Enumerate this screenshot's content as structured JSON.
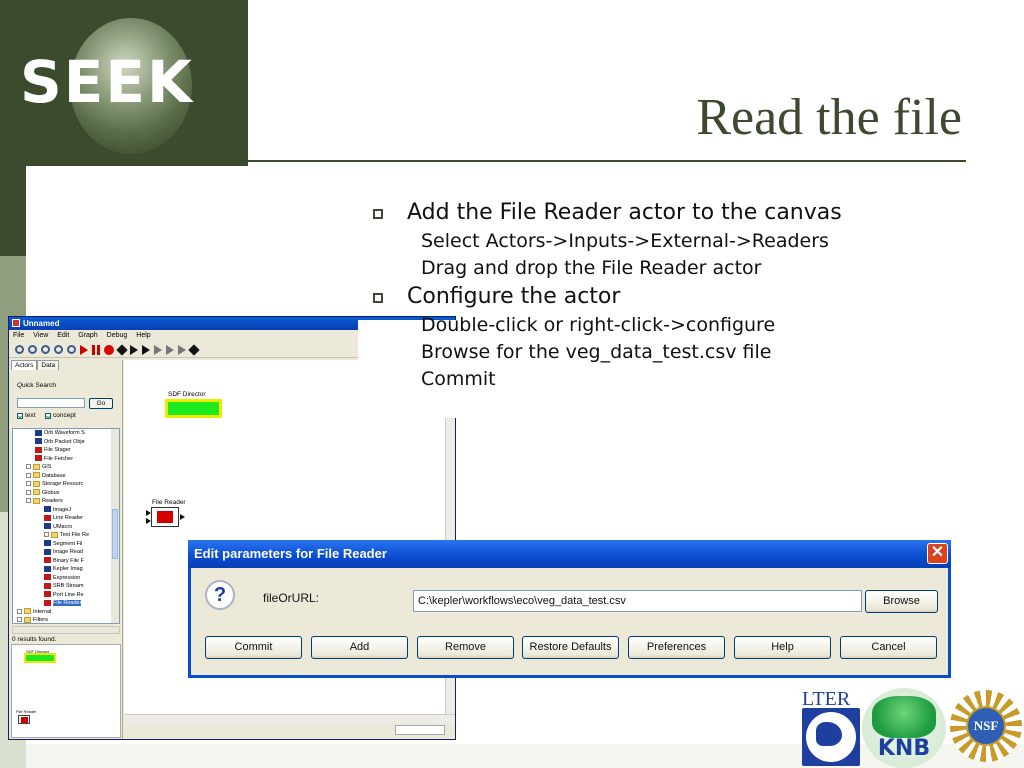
{
  "slide": {
    "logo_text": "SEEK",
    "title": "Read the file",
    "bullets": [
      {
        "text": "Add the File Reader actor to the canvas",
        "sub": [
          "Select Actors->Inputs->External->Readers",
          "Drag and drop the File Reader actor"
        ]
      },
      {
        "text": "Configure the actor",
        "sub": [
          "Double-click or right-click->configure",
          "Browse for the veg_data_test.csv file",
          "Commit"
        ]
      }
    ]
  },
  "kepler": {
    "window_title": "Unnamed",
    "menu": [
      "File",
      "View",
      "Edit",
      "Graph",
      "Debug",
      "Help"
    ],
    "tabs": [
      "Actors",
      "Data"
    ],
    "quick_search_label": "Quick Search",
    "go_label": "Go",
    "checks": [
      "text",
      "concept"
    ],
    "tree": [
      {
        "label": "Orb Waveform S",
        "indent": 4,
        "icon": "actor"
      },
      {
        "label": "Orb Packet Obje",
        "indent": 4,
        "icon": "actor"
      },
      {
        "label": "File Stager",
        "indent": 4,
        "icon": "actor-red"
      },
      {
        "label": "File Fetcher",
        "indent": 4,
        "icon": "actor-red"
      },
      {
        "label": "GIS",
        "indent": 3,
        "icon": "folder"
      },
      {
        "label": "Database",
        "indent": 3,
        "icon": "folder"
      },
      {
        "label": "Storage Resourc",
        "indent": 3,
        "icon": "folder"
      },
      {
        "label": "Globus",
        "indent": 3,
        "icon": "folder"
      },
      {
        "label": "Readers",
        "indent": 3,
        "icon": "folder"
      },
      {
        "label": "ImageJ",
        "indent": 5,
        "icon": "actor"
      },
      {
        "label": "Line Reader",
        "indent": 5,
        "icon": "actor-red"
      },
      {
        "label": "UMacro",
        "indent": 5,
        "icon": "actor"
      },
      {
        "label": "Text File Re",
        "indent": 5,
        "icon": "folder"
      },
      {
        "label": "Segment Fil",
        "indent": 5,
        "icon": "actor"
      },
      {
        "label": "Image Read",
        "indent": 5,
        "icon": "actor"
      },
      {
        "label": "Binary File F",
        "indent": 5,
        "icon": "actor-red"
      },
      {
        "label": "Kepler Imag",
        "indent": 5,
        "icon": "actor"
      },
      {
        "label": "Expression",
        "indent": 5,
        "icon": "actor-red"
      },
      {
        "label": "SRB Stream",
        "indent": 5,
        "icon": "actor-red"
      },
      {
        "label": "Port Line Re",
        "indent": 5,
        "icon": "actor-red"
      },
      {
        "label": "File Reader",
        "indent": 5,
        "icon": "actor-red",
        "selected": true
      },
      {
        "label": "Internal",
        "indent": 2,
        "icon": "folder"
      },
      {
        "label": "Filters",
        "indent": 2,
        "icon": "folder"
      }
    ],
    "results": "0 results found.",
    "nav_director": "SDF Director",
    "nav_file_reader": "File Reader",
    "canvas_director_label": "SDF Director",
    "canvas_file_reader_label": "File Reader"
  },
  "dialog": {
    "title": "Edit parameters for File Reader",
    "field_label": "fileOrURL:",
    "field_value": "C:\\kepler\\workflows\\eco\\veg_data_test.csv",
    "browse_label": "Browse",
    "buttons": [
      "Commit",
      "Add",
      "Remove",
      "Restore Defaults",
      "Preferences",
      "Help",
      "Cancel"
    ]
  },
  "partners": {
    "lter": "LTER",
    "knb": "KNB",
    "nsf": "NSF"
  }
}
